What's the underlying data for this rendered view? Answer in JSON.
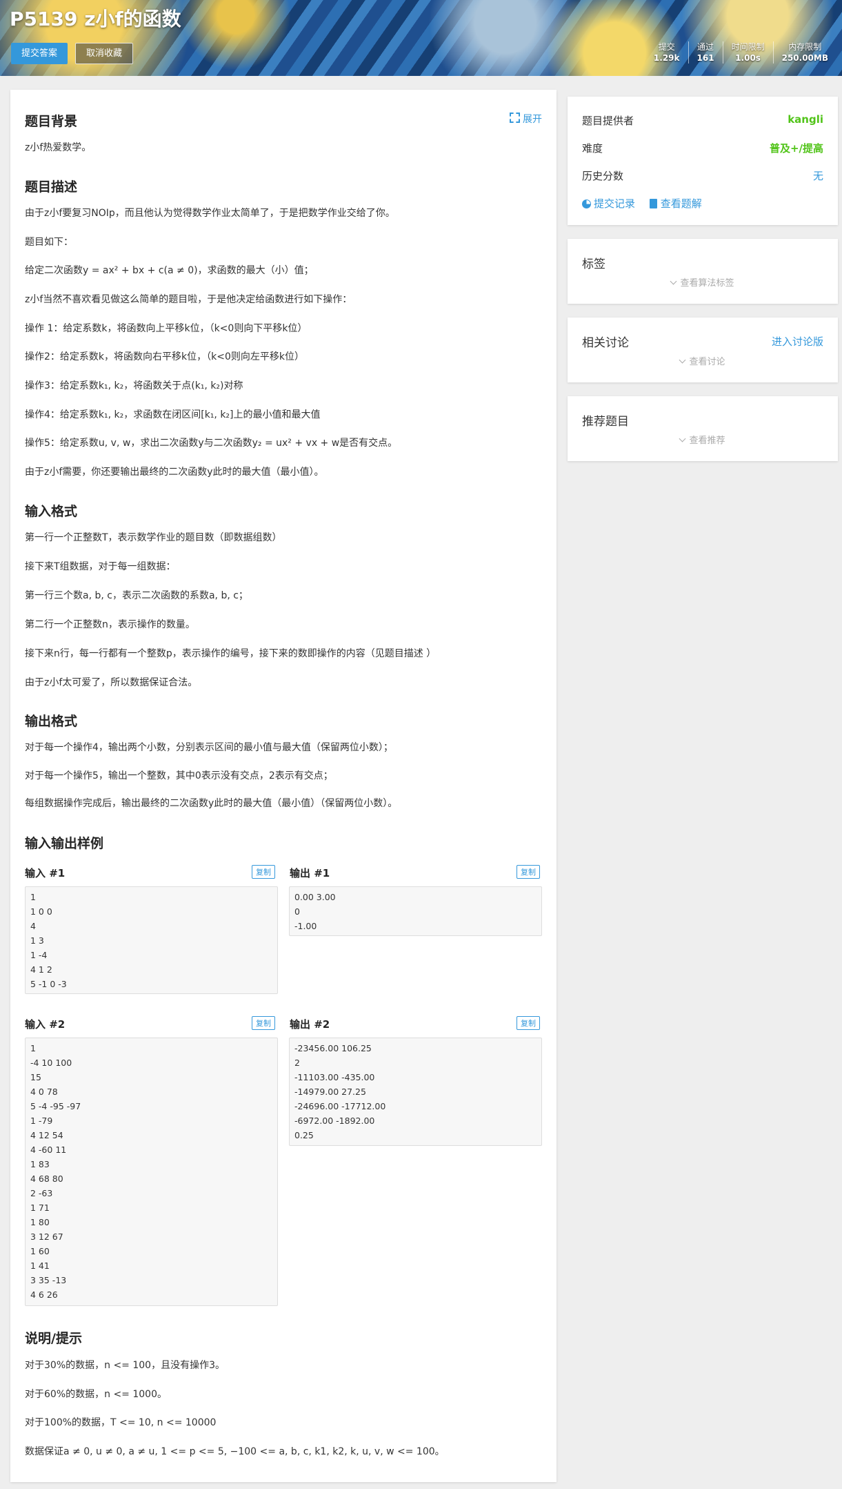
{
  "header": {
    "title": "P5139 z小f的函数",
    "submit_label": "提交答案",
    "unfavorite_label": "取消收藏",
    "stats": [
      {
        "label": "提交",
        "value": "1.29k"
      },
      {
        "label": "通过",
        "value": "161"
      },
      {
        "label": "时间限制",
        "value": "1.00s"
      },
      {
        "label": "内存限制",
        "value": "250.00MB"
      }
    ]
  },
  "problem": {
    "expand_label": "展开",
    "background": {
      "title": "题目背景",
      "lines": [
        "z小f热爱数学。"
      ]
    },
    "description": {
      "title": "题目描述",
      "lines": [
        "由于z小f要复习NOIp，而且他认为觉得数学作业太简单了，于是把数学作业交给了你。",
        "题目如下：",
        "给定二次函数y = ax² + bx + c(a ≠ 0)，求函数的最大（小）值；",
        "z小f当然不喜欢看见做这么简单的题目啦，于是他决定给函数进行如下操作：",
        "操作 1：给定系数k，将函数向上平移k位，（k<0则向下平移k位）",
        "操作2：给定系数k，将函数向右平移k位，（k<0则向左平移k位）",
        "操作3：给定系数k₁, k₂，将函数关于点(k₁, k₂)对称",
        "操作4：给定系数k₁, k₂，求函数在闭区间[k₁, k₂]上的最小值和最大值",
        "操作5：给定系数u, v, w，求出二次函数y与二次函数y₂ = ux² + vx + w是否有交点。",
        "由于z小f需要，你还要输出最终的二次函数y此时的最大值（最小值）。"
      ]
    },
    "input_format": {
      "title": "输入格式",
      "lines": [
        "第一行一个正整数T，表示数学作业的题目数（即数据组数）",
        "接下来T组数据，对于每一组数据：",
        "第一行三个数a, b, c，表示二次函数的系数a, b, c；",
        "第二行一个正整数n，表示操作的数量。",
        "接下来n行，每一行都有一个整数p，表示操作的编号，接下来的数即操作的内容（见题目描述 ）",
        "由于z小f太可爱了，所以数据保证合法。"
      ]
    },
    "output_format": {
      "title": "输出格式",
      "lines": [
        "对于每一个操作4，输出两个小数，分别表示区间的最小值与最大值（保留两位小数）；",
        "对于每一个操作5，输出一个整数，其中0表示没有交点，2表示有交点；",
        "每组数据操作完成后，输出最终的二次函数y此时的最大值（最小值）（保留两位小数）。"
      ]
    },
    "samples": {
      "title": "输入输出样例",
      "copy_label": "复制",
      "input1_label": "输入 #1",
      "output1_label": "输出 #1",
      "input2_label": "输入 #2",
      "output2_label": "输出 #2",
      "input1": [
        "1",
        "1 0 0",
        "4",
        "1 3",
        "1 -4",
        "4 1 2",
        "5 -1 0 -3"
      ],
      "output1": [
        "0.00 3.00",
        "0",
        "-1.00"
      ],
      "input2": [
        "1",
        "-4 10 100",
        "15",
        "4 0 78",
        "5 -4 -95 -97",
        "1 -79",
        "4 12 54",
        "4 -60 11",
        "1 83",
        "4 68 80",
        "2 -63",
        "1 71",
        "1 80",
        "3 12 67",
        "1 60",
        "1 41",
        "3 35 -13",
        "4 6 26"
      ],
      "output2": [
        "-23456.00 106.25",
        "2",
        "-11103.00 -435.00",
        "-14979.00 27.25",
        "-24696.00 -17712.00",
        "-6972.00 -1892.00",
        "0.25"
      ]
    },
    "hint": {
      "title": "说明/提示",
      "lines": [
        "对于30%的数据，n <= 100，且没有操作3。",
        "对于60%的数据，n <= 1000。",
        "对于100%的数据，T <= 10, n <= 10000",
        "数据保证a ≠ 0, u ≠ 0, a ≠ u, 1 <= p <= 5, −100 <= a, b, c, k1, k2, k, u, v, w <= 100。"
      ]
    }
  },
  "sidebar": {
    "info": {
      "provider_label": "题目提供者",
      "provider_value": "kangli",
      "difficulty_label": "难度",
      "difficulty_value": "普及+/提高",
      "history_label": "历史分数",
      "history_value": "无",
      "records_label": "提交记录",
      "solutions_label": "查看题解"
    },
    "tags": {
      "title": "标签",
      "hint": "查看算法标签"
    },
    "discussion": {
      "title": "相关讨论",
      "link": "进入讨论版",
      "hint": "查看讨论"
    },
    "recommend": {
      "title": "推荐题目",
      "hint": "查看推荐"
    }
  }
}
